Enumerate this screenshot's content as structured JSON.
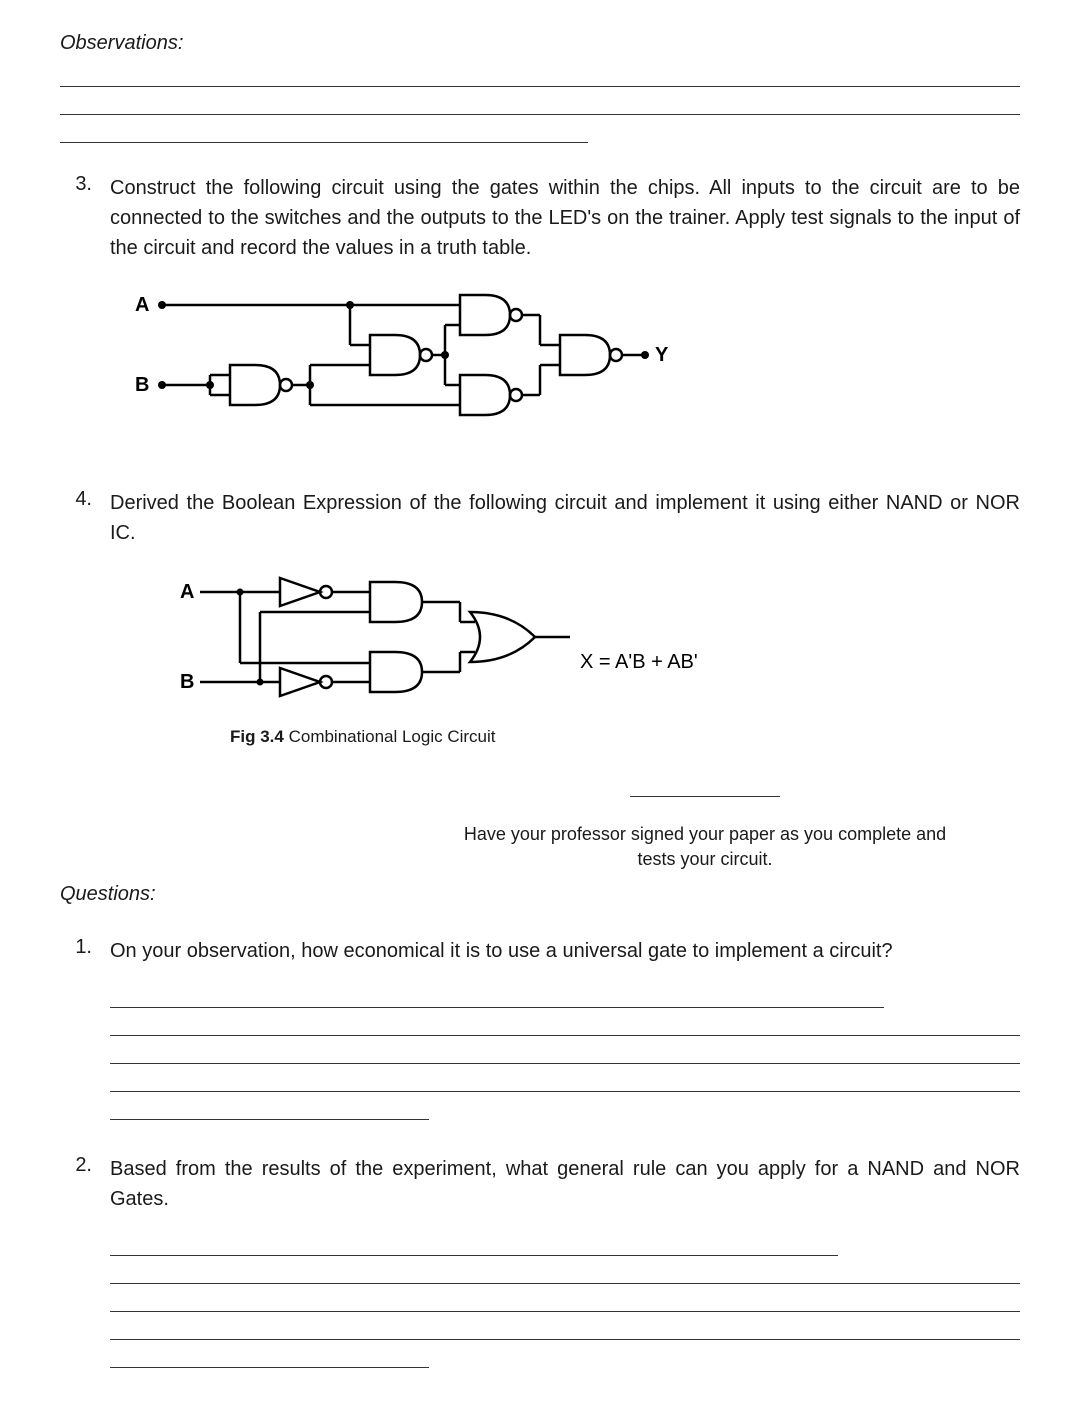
{
  "observations_heading": "Observations:",
  "item3": {
    "number": "3.",
    "text": "Construct the following circuit using the gates within the chips. All inputs to the circuit are to be connected to the switches and the outputs to the LED's on the trainer. Apply test signals to the input of the circuit and record the values in a truth table."
  },
  "circuit1": {
    "labelA": "A",
    "labelB": "B",
    "labelY": "Y"
  },
  "item4": {
    "number": "4.",
    "text": "Derived the Boolean Expression of the following circuit and implement it using either NAND or NOR IC."
  },
  "circuit2": {
    "labelA": "A",
    "labelB": "B",
    "equation": "X = A'B + AB'"
  },
  "fig_caption": {
    "bold": "Fig 3.4",
    "text": " Combinational Logic Circuit"
  },
  "instruction_note_line1": "Have your professor signed your paper as you complete and",
  "instruction_note_line2": "tests your circuit.",
  "questions_heading": "Questions:",
  "q1": {
    "number": "1.",
    "text": "On your observation, how economical it is to use a universal gate to implement a circuit?"
  },
  "q2": {
    "number": "2.",
    "text": "Based from the results of the experiment, what general rule can you apply for a NAND and NOR Gates."
  }
}
